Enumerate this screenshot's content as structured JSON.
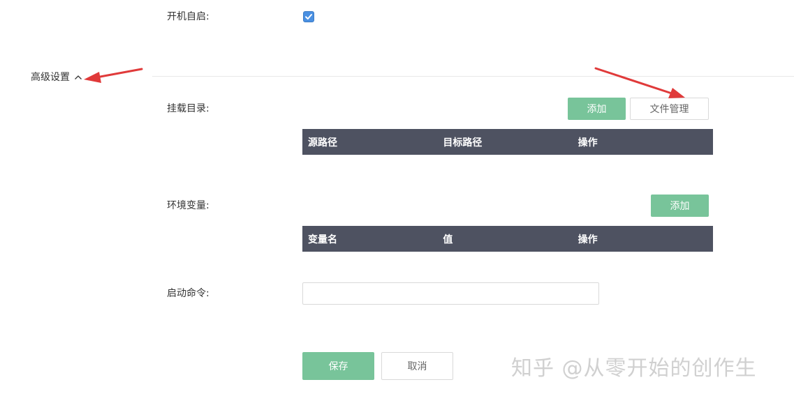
{
  "autostart": {
    "label": "开机自启:",
    "checked": true
  },
  "advanced": {
    "title": "高级设置",
    "toggle_icon": "chevron-up-icon"
  },
  "mount": {
    "label": "挂载目录:",
    "add_label": "添加",
    "file_manage_label": "文件管理",
    "columns": [
      "源路径",
      "目标路径",
      "操作"
    ]
  },
  "env": {
    "label": "环境变量:",
    "add_label": "添加",
    "columns": [
      "变量名",
      "值",
      "操作"
    ]
  },
  "command": {
    "label": "启动命令:",
    "value": "",
    "placeholder": ""
  },
  "actions": {
    "save_label": "保存",
    "cancel_label": "取消"
  },
  "watermark": {
    "text": "知乎 @从零开始的创作生"
  },
  "colors": {
    "accent_green": "#78c49a",
    "table_header": "#4e5261",
    "checkbox_blue": "#4a90e2",
    "annotation_red": "#e03a3a"
  }
}
